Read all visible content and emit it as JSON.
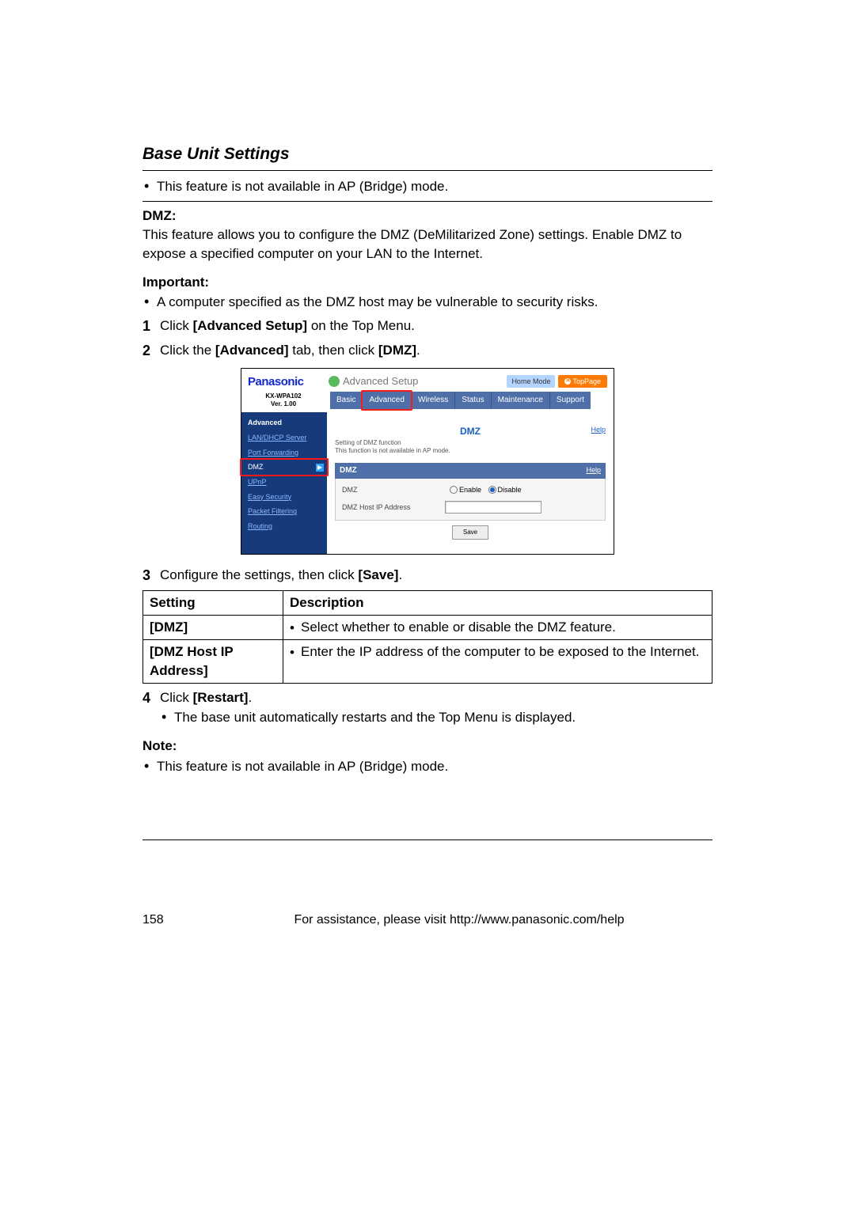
{
  "header": {
    "section_title": "Base Unit Settings"
  },
  "intro_bullet": "This feature is not available in AP (Bridge) mode.",
  "dmz_heading": "DMZ:",
  "dmz_text": "This feature allows you to configure the DMZ (DeMilitarized Zone) settings. Enable DMZ to expose a specified computer on your LAN to the Internet.",
  "important_label": "Important:",
  "important_bullet": "A computer specified as the DMZ host may be vulnerable to security risks.",
  "steps": {
    "s1_num": "1",
    "s1_pre": "Click ",
    "s1_bold": "[Advanced Setup]",
    "s1_post": " on the Top Menu.",
    "s2_num": "2",
    "s2_pre": "Click the ",
    "s2_bold1": "[Advanced]",
    "s2_mid": " tab, then click ",
    "s2_bold2": "[DMZ]",
    "s2_post": ".",
    "s3_num": "3",
    "s3_pre": "Configure the settings, then click ",
    "s3_bold": "[Save]",
    "s3_post": ".",
    "s4_num": "4",
    "s4_pre": "Click ",
    "s4_bold": "[Restart]",
    "s4_post": ".",
    "s4_sub_bullet": "The base unit automatically restarts and the Top Menu is displayed."
  },
  "screenshot": {
    "logo": "Panasonic",
    "model": "KX-WPA102",
    "version": "Ver. 1.00",
    "title": "Advanced Setup",
    "home_mode": "Home Mode",
    "top_page": "TopPage",
    "tabs": [
      "Basic",
      "Advanced",
      "Wireless",
      "Status",
      "Maintenance",
      "Support"
    ],
    "sidebar_title": "Advanced",
    "sidebar_items": [
      "LAN/DHCP Server",
      "Port Forwarding",
      "DMZ",
      "UPnP",
      "Easy Security",
      "Packet Filtering",
      "Routing"
    ],
    "page_heading": "DMZ",
    "help": "Help",
    "sub1": "Setting of DMZ function",
    "sub2": "This function is not available in AP mode.",
    "pane_title": "DMZ",
    "row1_label": "DMZ",
    "enable": "Enable",
    "disable": "Disable",
    "row2_label": "DMZ Host IP Address",
    "save": "Save"
  },
  "table": {
    "h1": "Setting",
    "h2": "Description",
    "r1c1": "[DMZ]",
    "r1c2": "Select whether to enable or disable the DMZ feature.",
    "r2c1": "[DMZ Host IP Address]",
    "r2c2": "Enter the IP address of the computer to be exposed to the Internet."
  },
  "note_label": "Note:",
  "note_bullet": "This feature is not available in AP (Bridge) mode.",
  "footer": {
    "page": "158",
    "assist": "For assistance, please visit http://www.panasonic.com/help"
  }
}
